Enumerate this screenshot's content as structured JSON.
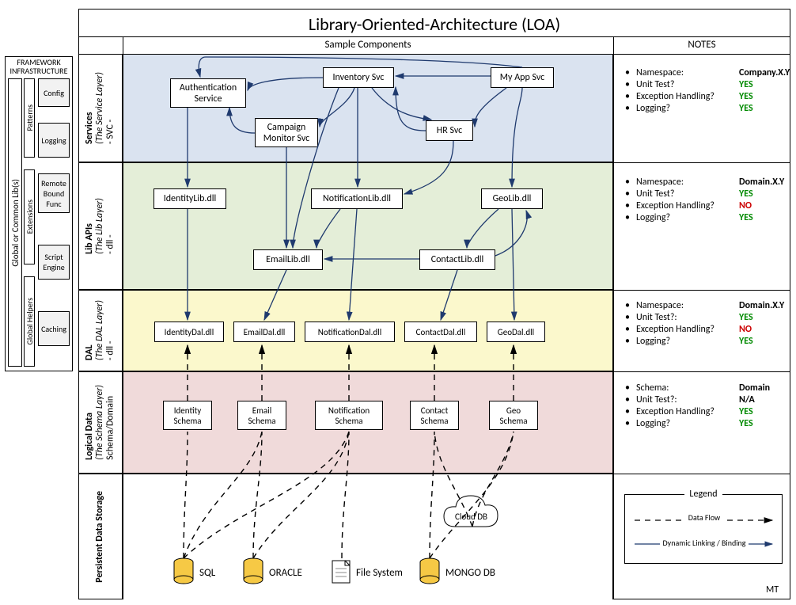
{
  "title": "Library-Oriented-Architecture (LOA)",
  "headers": {
    "left": "Sample Components",
    "right": "NOTES"
  },
  "framework": {
    "title": "FRAMEWORK INFRASTRUCTURE",
    "outer": "Global or Common Lib(s)",
    "groups": [
      "Patterns",
      "Extensions",
      "Global Helpers"
    ],
    "items": [
      "Config",
      "Logging",
      "Remote Bound Func",
      "Script Engine",
      "Caching"
    ]
  },
  "layers": {
    "services": {
      "name": "Services",
      "sub": "(The Service Layer)",
      "tag": "- SVC -"
    },
    "lib": {
      "name": "Lib APIs",
      "sub": "(The Lib Layer)",
      "tag": "- dll -"
    },
    "dal": {
      "name": "DAL",
      "sub": "(The DAL Layer)",
      "tag": "- dll -"
    },
    "schema": {
      "name": "Logical Data",
      "sub": "(The Schema Layer)",
      "tag": "Schema/Domain"
    },
    "storage": {
      "name": "Persistent Data Storage"
    }
  },
  "services": {
    "auth": "Authentication Service",
    "inv": "Inventory Svc",
    "myapp": "My App Svc",
    "camp": "Campaign Monitor Svc",
    "hr": "HR Svc"
  },
  "libs": {
    "identity": "IdentityLib.dll",
    "notif": "NotificationLib.dll",
    "geo": "GeoLib.dll",
    "email": "EmailLib.dll",
    "contact": "ContactLib.dll"
  },
  "dals": [
    "IdentityDal.dll",
    "EmailDal.dll",
    "NotificationDal.dll",
    "ContactDal.dll",
    "GeoDal.dll"
  ],
  "schemas": [
    "Identity Schema",
    "Email Schema",
    "Notification Schema",
    "Contact Schema",
    "Geo Schema"
  ],
  "storage": {
    "sql": "SQL",
    "oracle": "ORACLE",
    "fs": "File System",
    "mongo": "MONGO DB",
    "cloud": "Cloud DB"
  },
  "notes": {
    "services": [
      {
        "label": "Namespace:",
        "value": "Company.X.Y",
        "cls": "val"
      },
      {
        "label": "Unit Test?",
        "value": "YES",
        "cls": "yes"
      },
      {
        "label": "Exception Handling?",
        "value": "YES",
        "cls": "yes"
      },
      {
        "label": "Logging?",
        "value": "YES",
        "cls": "yes"
      }
    ],
    "lib": [
      {
        "label": "Namespace:",
        "value": "Domain.X.Y",
        "cls": "val"
      },
      {
        "label": "Unit Test?",
        "value": "YES",
        "cls": "yes"
      },
      {
        "label": "Exception Handling?",
        "value": "NO",
        "cls": "no"
      },
      {
        "label": "Logging?",
        "value": "YES",
        "cls": "yes"
      }
    ],
    "dal": [
      {
        "label": "Namespace:",
        "value": "Domain.X.Y",
        "cls": "val"
      },
      {
        "label": "Unit Test?:",
        "value": "YES",
        "cls": "yes"
      },
      {
        "label": "Exception Handling?",
        "value": "NO",
        "cls": "no"
      },
      {
        "label": "Logging?",
        "value": "YES",
        "cls": "yes"
      }
    ],
    "schema": [
      {
        "label": "Schema:",
        "value": "Domain",
        "cls": "val"
      },
      {
        "label": "Unit Test?:",
        "value": "N/A",
        "cls": "val"
      },
      {
        "label": "Exception Handling?",
        "value": "YES",
        "cls": "yes"
      },
      {
        "label": "Logging?",
        "value": "YES",
        "cls": "yes"
      }
    ]
  },
  "legend": {
    "title": "Legend",
    "flow": "Data Flow",
    "bind": "Dynamic Linking / Binding"
  },
  "footer": "MT"
}
